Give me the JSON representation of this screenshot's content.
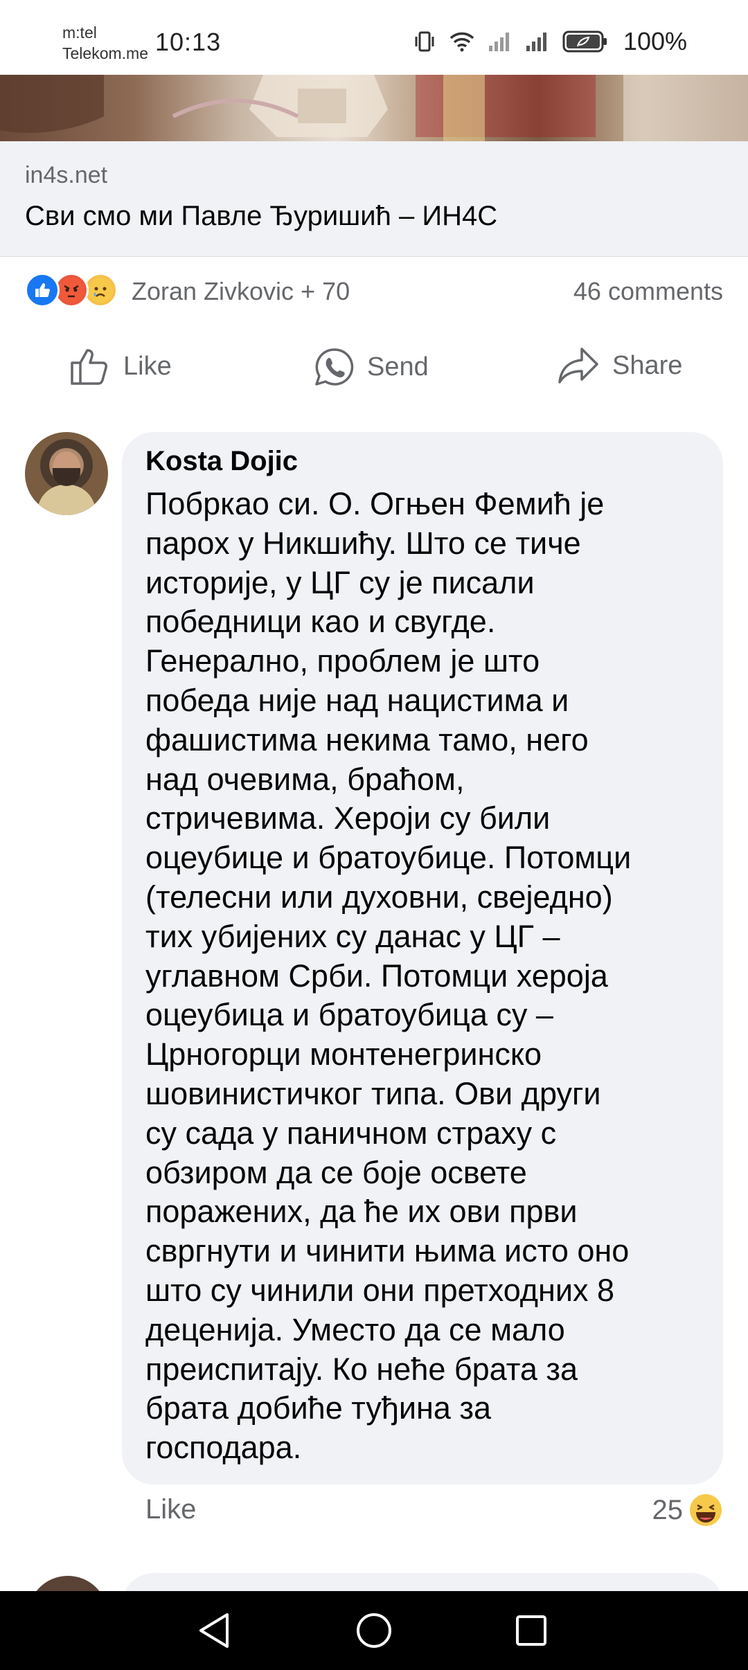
{
  "status_bar": {
    "carrier_line1": "m:tel",
    "carrier_line2": "Telekom.me",
    "time": "10:13",
    "battery": "100%",
    "icons": [
      "vibrate-icon",
      "wifi-icon",
      "signal-icon",
      "signal-icon",
      "battery-icon"
    ]
  },
  "link_preview": {
    "domain": "in4s.net",
    "title": "Сви смо ми Павле Ђуришић – ИН4С"
  },
  "reactions": {
    "icons": [
      "like-reaction-icon",
      "angry-reaction-icon",
      "sad-reaction-icon"
    ],
    "text": "Zoran Zivkovic + 70",
    "comments_count": "46 comments"
  },
  "actions": {
    "like": "Like",
    "send": "Send",
    "share": "Share"
  },
  "comment": {
    "author": "Kosta Dojic",
    "text": "Побркао си. О. Огњен Фемић је\nпарох у Никшићу. Што се тиче\nисторије, у ЦГ су је писали\nпобедници као и свугде.\nГенерално, проблем је што\nпобеда није над нацистима и\nфашистима некима тамо, него\nнад очевима, браћом,\nстричевима. Хероји су били\nоцеубице и братоубице. Потомци\n(телесни или духовни, свеједно)\nтих убијених су данас у ЦГ –\nуглавном Срби. Потомци хероја\nоцеубица и братоубица су –\nЦрногорци монтенегринско\nшовинистичког типа. Ови други\nсу сада у паничном страху с\nобзиром да се боје освете\nпоражених, да ће их ови први\nсвргнути и чинити њима исто оно\nшто су чинили они претходних  8\nдеценија. Уместо да се мало\nпреиспитају. Ко неће брата за\nбрата добиће туђина за\nгосподара.",
    "like_label": "Like",
    "reaction_count": "25",
    "reaction_icon": "laughing-reaction-icon"
  },
  "colors": {
    "secondary_text": "#65676b",
    "bubble_bg": "#f0f2f5",
    "like_blue": "#1877f2"
  }
}
